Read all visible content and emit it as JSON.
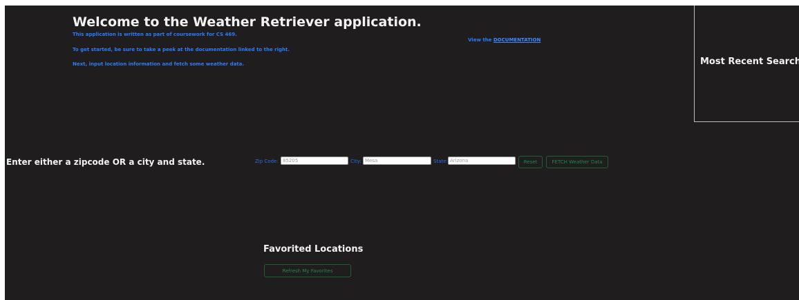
{
  "header": {
    "title": "Welcome to the Weather Retriever application.",
    "lines": [
      "This application is written as part of coursework for CS 469.",
      "To get started, be sure to take a peek at the documentation linked to the right.",
      "Next, input location information and fetch some weather data."
    ],
    "doc_prefix": "View the ",
    "doc_link": "DOCUMENTATION"
  },
  "recent": {
    "title": "Most Recent Searches"
  },
  "form": {
    "prompt": "Enter either a zipcode OR a city and state.",
    "zip_label": "Zip Code:",
    "zip_value": "85205",
    "city_label": "City:",
    "city_value": "Mesa",
    "state_label": "State:",
    "state_value": "Arizona",
    "reset_label": "Reset",
    "fetch_label": "FETCH Weather Data"
  },
  "favorites": {
    "title": "Favorited Locations",
    "refresh_label": "Refresh My Favorites"
  },
  "colors": {
    "background": "#1f1d1e",
    "accent_blue": "#2e7cf5",
    "button_green": "#24874a"
  }
}
